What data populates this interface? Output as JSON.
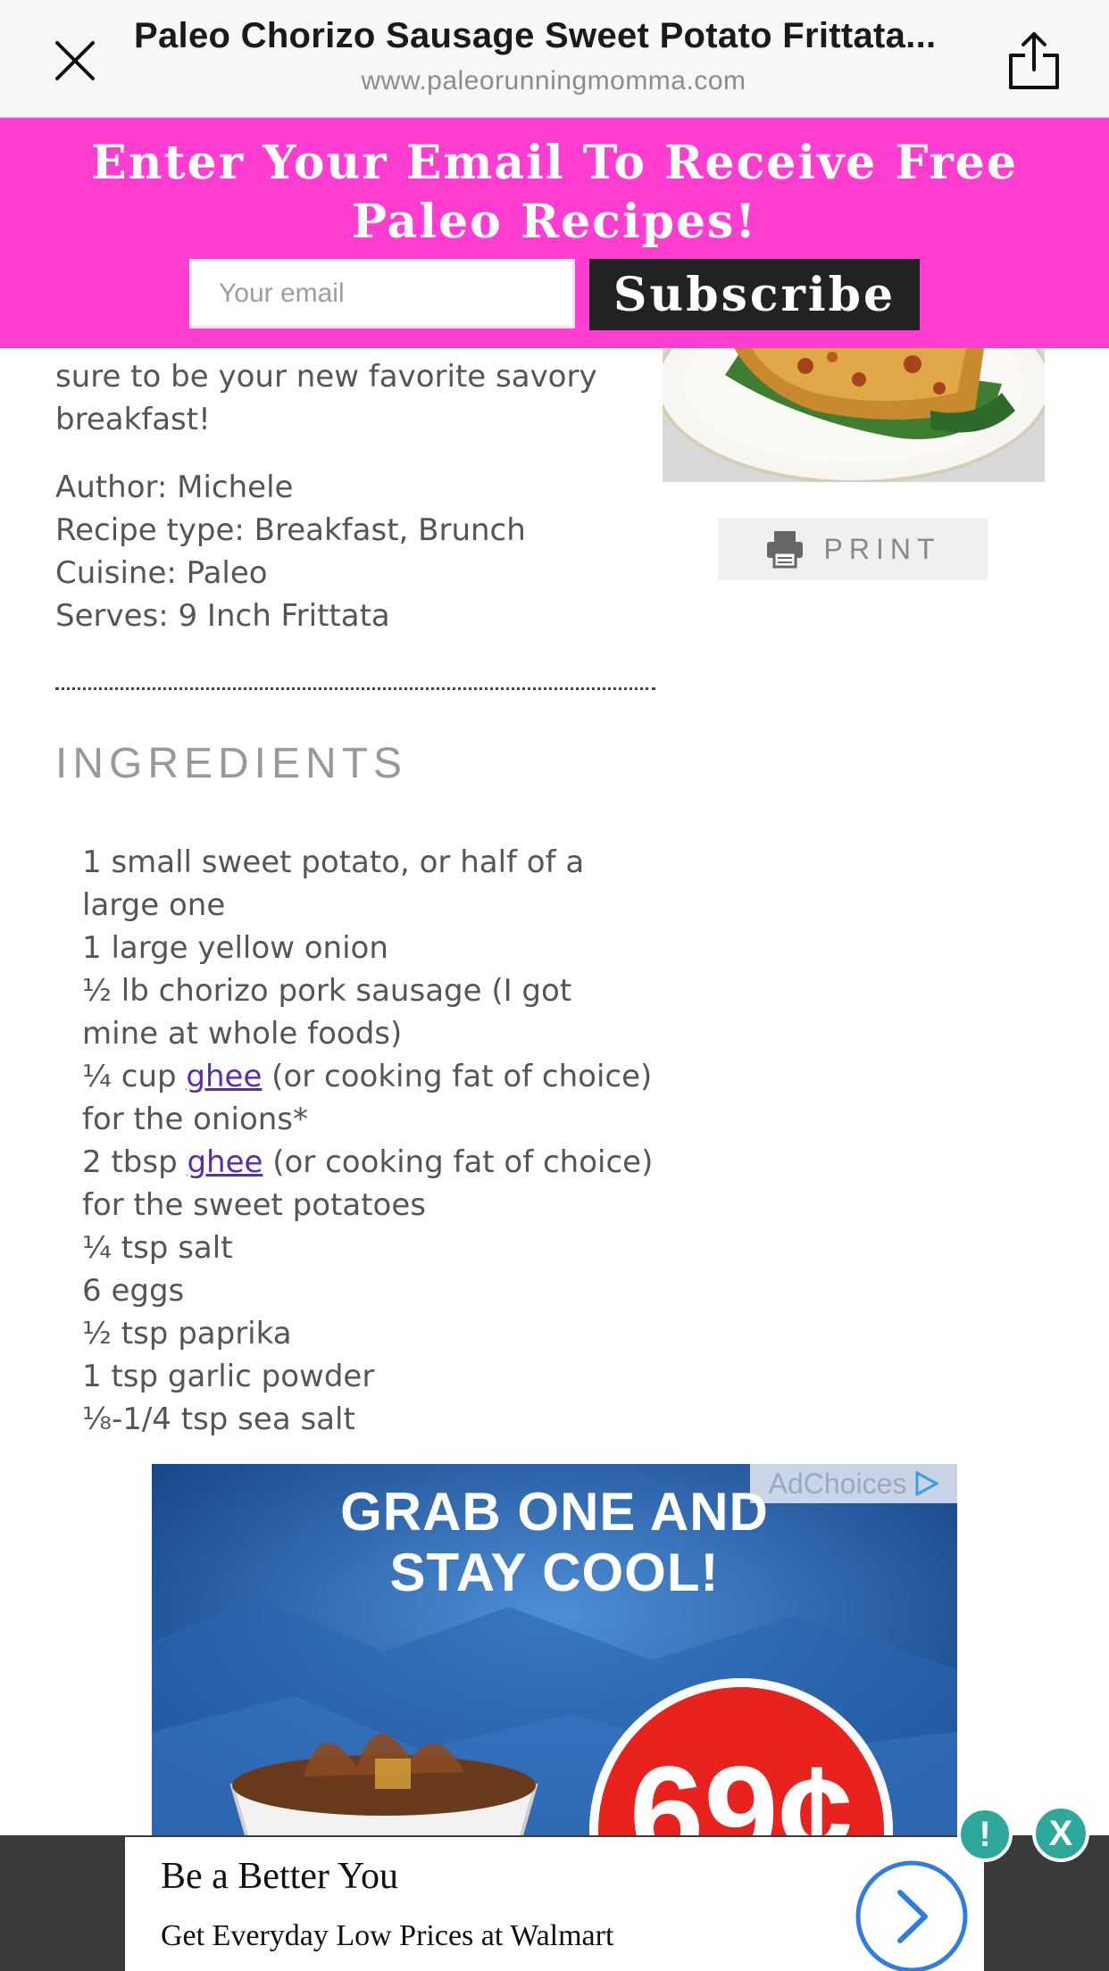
{
  "browser": {
    "title": "Paleo Chorizo Sausage Sweet Potato Frittata...",
    "url": "www.paleorunningmomma.com",
    "close_icon": "close-icon",
    "share_icon": "share-icon"
  },
  "banner": {
    "headline": "Enter Your Email To Receive Free Paleo Recipes!",
    "email_placeholder": "Your email",
    "subscribe_label": "Subscribe",
    "background_color": "#ff3ed1"
  },
  "recipe": {
    "intro_tail": "sure to be your new favorite savory breakfast!",
    "meta": [
      "Author: Michele",
      "Recipe type: Breakfast, Brunch",
      "Cuisine: Paleo",
      "Serves: 9 Inch Frittata"
    ],
    "print_label": "PRINT",
    "ingredients_heading": "INGREDIENTS",
    "ingredients": [
      {
        "before": "1 small sweet potato, or half of a large one"
      },
      {
        "before": "1 large yellow onion"
      },
      {
        "before": "½ lb chorizo pork sausage (I got mine at whole foods)"
      },
      {
        "before": "¼ cup ",
        "link": "ghee",
        "after": " (or cooking fat of choice) for the onions*"
      },
      {
        "before": "2 tbsp ",
        "link": "ghee",
        "after": " (or cooking fat of choice) for the sweet potatoes"
      },
      {
        "before": "¼ tsp salt"
      },
      {
        "before": "6 eggs"
      },
      {
        "before": "½ tsp paprika"
      },
      {
        "before": "1 tsp garlic powder"
      },
      {
        "before": "⅛-1/4 tsp sea salt"
      }
    ]
  },
  "ad": {
    "adchoices_label": "AdChoices",
    "headline_line1": "GRAB ONE AND",
    "headline_line2": "STAY COOL!",
    "price": "69¢"
  },
  "sticky_ad": {
    "title": "Be a Better You",
    "subtitle": "Get Everyday Low Prices at Walmart",
    "info_label": "!",
    "close_label": "X"
  }
}
